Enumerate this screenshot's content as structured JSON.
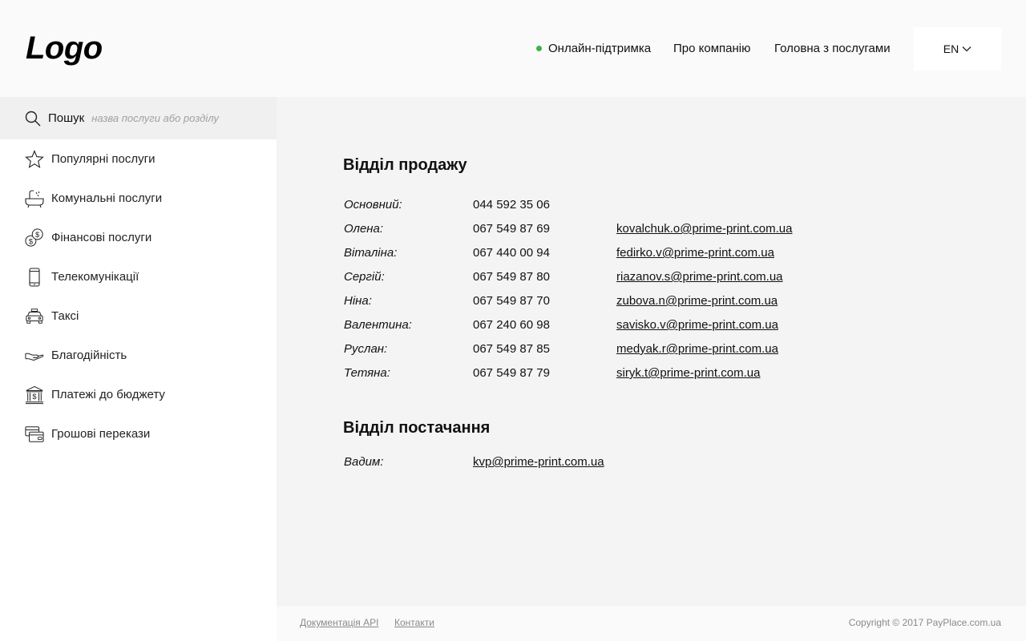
{
  "header": {
    "logo": "Logo",
    "nav": {
      "support": "Онлайн-підтримка",
      "about": "Про компанію",
      "home": "Головна з послугами"
    },
    "lang": "EN",
    "status_color": "#3db34a"
  },
  "sidebar": {
    "search": {
      "label": "Пошук",
      "placeholder": "назва послуги або розділу",
      "icon": "search-icon"
    },
    "items": [
      {
        "label": "Популярні послуги",
        "icon": "star-icon"
      },
      {
        "label": "Комунальні послуги",
        "icon": "bathtub-icon"
      },
      {
        "label": "Фінансові послуги",
        "icon": "coins-icon"
      },
      {
        "label": "Телекомунікації",
        "icon": "phone-icon"
      },
      {
        "label": "Таксі",
        "icon": "taxi-icon"
      },
      {
        "label": "Благодійність",
        "icon": "hand-icon"
      },
      {
        "label": "Платежі до бюджету",
        "icon": "bank-icon"
      },
      {
        "label": "Грошові перекази",
        "icon": "cards-icon"
      }
    ]
  },
  "main": {
    "sales": {
      "title": "Відділ продажу",
      "rows": [
        {
          "name": "Основний:",
          "phone": "044 592 35 06",
          "email": ""
        },
        {
          "name": "Олена:",
          "phone": "067 549 87 69",
          "email": "kovalchuk.o@prime-print.com.ua"
        },
        {
          "name": "Віталіна:",
          "phone": "067 440 00 94",
          "email": "fedirko.v@prime-print.com.ua"
        },
        {
          "name": "Сергій:",
          "phone": "067 549 87 80",
          "email": "riazanov.s@prime-print.com.ua"
        },
        {
          "name": "Ніна:",
          "phone": "067 549 87 70",
          "email": "zubova.n@prime-print.com.ua"
        },
        {
          "name": "Валентина:",
          "phone": "067 240 60 98",
          "email": "savisko.v@prime-print.com.ua"
        },
        {
          "name": "Руслан:",
          "phone": "067 549 87 85",
          "email": "medyak.r@prime-print.com.ua"
        },
        {
          "name": "Тетяна:",
          "phone": "067 549 87 79",
          "email": "siryk.t@prime-print.com.ua"
        }
      ]
    },
    "supply": {
      "title": "Відділ постачання",
      "rows": [
        {
          "name": "Вадим:",
          "email": "kvp@prime-print.com.ua"
        }
      ]
    }
  },
  "footer": {
    "docs": "Документація API",
    "contacts": "Контакти",
    "copyright": "Copyright © 2017 PayPlace.com.ua"
  }
}
